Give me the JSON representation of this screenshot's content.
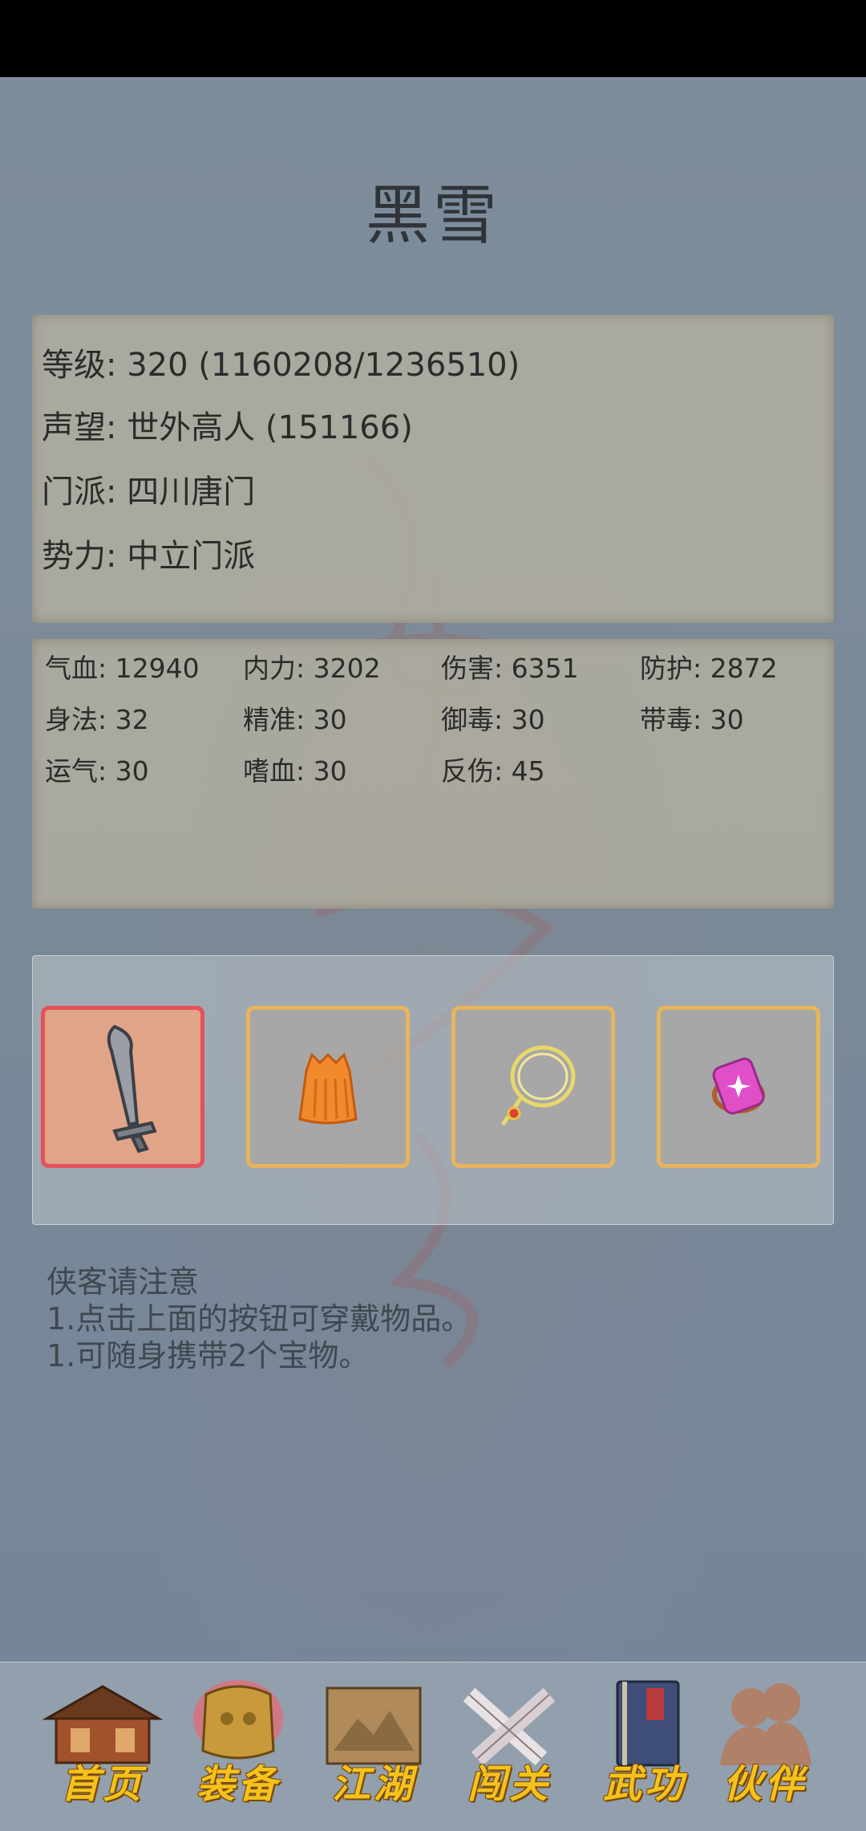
{
  "character": {
    "name": "黑雪"
  },
  "info": [
    "等级: 320 (1160208/1236510)",
    "声望: 世外高人 (151166)",
    "门派: 四川唐门",
    "势力:  中立门派"
  ],
  "stats": [
    "气血: 12940",
    "内力: 3202",
    "伤害: 6351",
    "防护: 2872",
    "身法: 32",
    "精准: 30",
    "御毒: 30",
    "带毒: 30",
    "运气: 30",
    "嗜血: 30",
    "反伤: 45"
  ],
  "equipment": {
    "slots": [
      {
        "icon": "sword-icon",
        "active": true
      },
      {
        "icon": "robe-icon",
        "active": false
      },
      {
        "icon": "necklace-icon",
        "active": false
      },
      {
        "icon": "ring-icon",
        "active": false
      }
    ]
  },
  "notice": {
    "title": "侠客请注意",
    "lines": [
      "1.点击上面的按钮可穿戴物品。",
      "1.可随身携带2个宝物。"
    ]
  },
  "nav": [
    {
      "label": "首页",
      "icon": "house-icon"
    },
    {
      "label": "装备",
      "icon": "armor-icon"
    },
    {
      "label": "江湖",
      "icon": "scroll-map-icon"
    },
    {
      "label": "闯关",
      "icon": "crossed-swords-icon"
    },
    {
      "label": "武功",
      "icon": "book-icon"
    },
    {
      "label": "伙伴",
      "icon": "companions-icon"
    }
  ]
}
